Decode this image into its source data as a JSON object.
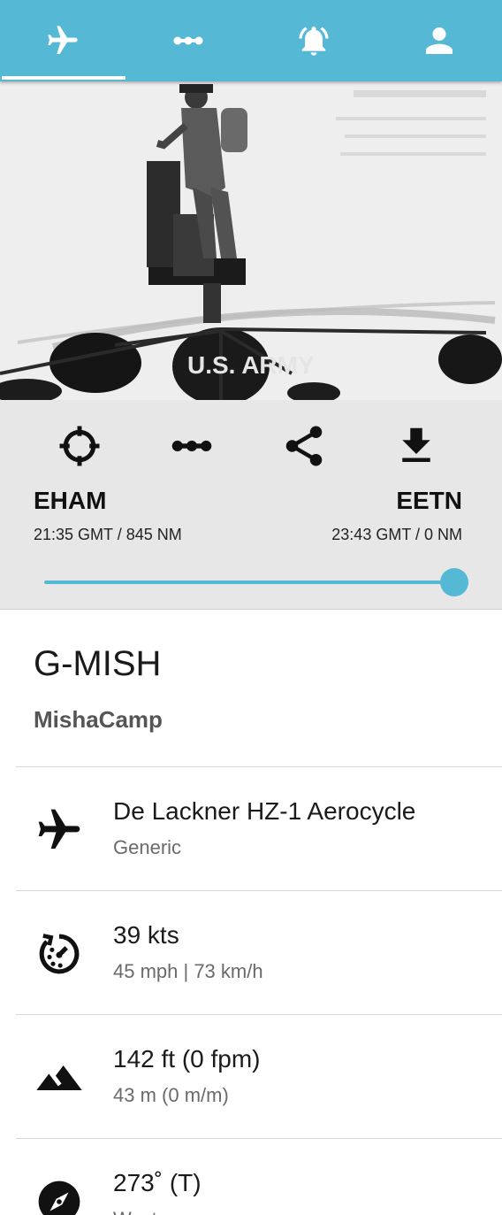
{
  "tabs": [
    {
      "icon": "airplane-icon"
    },
    {
      "icon": "route-icon"
    },
    {
      "icon": "bell-icon"
    },
    {
      "icon": "user-icon"
    }
  ],
  "active_tab": 0,
  "photo": {
    "caption_text": "U.S. ARMY"
  },
  "route": {
    "actions": [
      "crosshair-icon",
      "route-icon",
      "share-icon",
      "download-icon"
    ],
    "origin": {
      "code": "EHAM",
      "detail": "21:35 GMT / 845 NM"
    },
    "destination": {
      "code": "EETN",
      "detail": "23:43 GMT / 0 NM"
    },
    "progress": 1.0
  },
  "flight": {
    "registration": "G-MISH",
    "airline": "MishaCamp"
  },
  "details": [
    {
      "icon": "airplane-icon",
      "main": "De Lackner HZ-1 Aerocycle",
      "secondary": "Generic"
    },
    {
      "icon": "speed-icon",
      "main": "39 kts",
      "secondary": "45 mph | 73 km/h"
    },
    {
      "icon": "mountain-icon",
      "main": "142 ft (0 fpm)",
      "secondary": "43 m (0 m/m)"
    },
    {
      "icon": "compass-icon",
      "main": "273˚ (T)",
      "secondary": "West"
    }
  ],
  "colors": {
    "accent": "#55b9d6",
    "panel": "#e7e7e7"
  }
}
